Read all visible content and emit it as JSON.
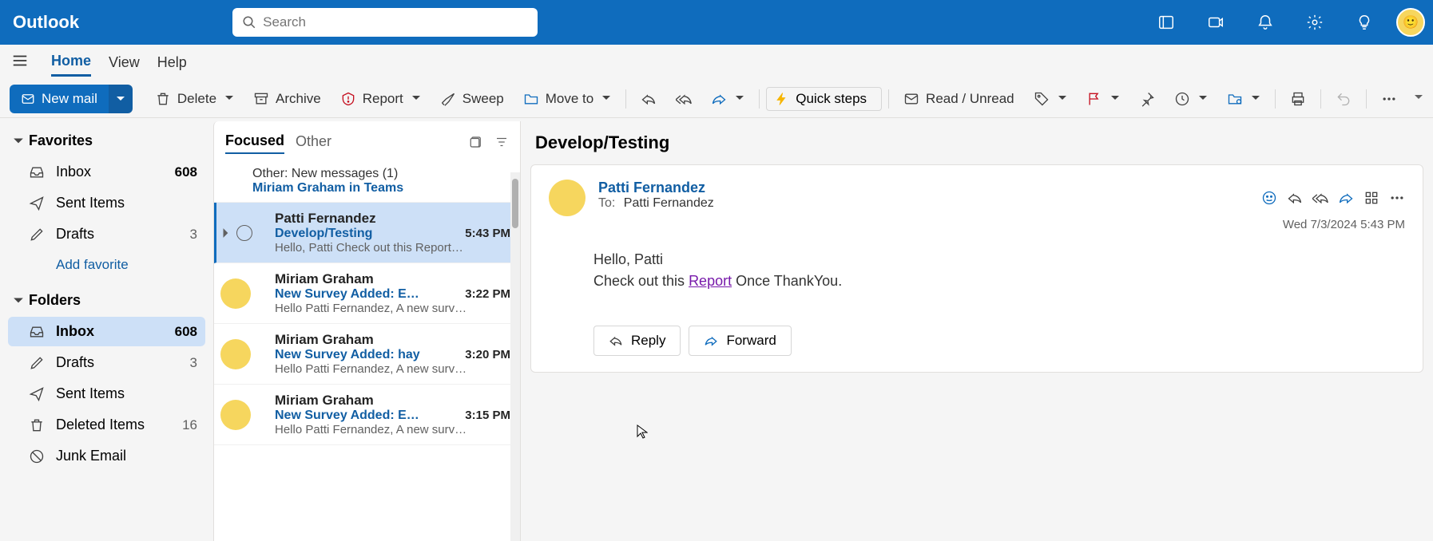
{
  "app": {
    "name": "Outlook"
  },
  "search": {
    "placeholder": "Search"
  },
  "tabs": {
    "home": "Home",
    "view": "View",
    "help": "Help"
  },
  "toolbar": {
    "newmail": "New mail",
    "delete": "Delete",
    "archive": "Archive",
    "report": "Report",
    "sweep": "Sweep",
    "moveto": "Move to",
    "quicksteps": "Quick steps",
    "readunread": "Read / Unread"
  },
  "sidebar": {
    "favorites": {
      "label": "Favorites",
      "inbox": {
        "label": "Inbox",
        "count": "608"
      },
      "sent": {
        "label": "Sent Items"
      },
      "drafts": {
        "label": "Drafts",
        "count": "3"
      },
      "add": "Add favorite"
    },
    "folders": {
      "label": "Folders",
      "inbox": {
        "label": "Inbox",
        "count": "608"
      },
      "drafts": {
        "label": "Drafts",
        "count": "3"
      },
      "sent": {
        "label": "Sent Items"
      },
      "deleted": {
        "label": "Deleted Items",
        "count": "16"
      },
      "junk": {
        "label": "Junk Email"
      }
    }
  },
  "msglist": {
    "focused": "Focused",
    "other": "Other",
    "banner": {
      "line1": "Other: New messages (1)",
      "line2": "Miriam Graham in Teams"
    },
    "items": [
      {
        "from": "Patti Fernandez",
        "subject": "Develop/Testing",
        "time": "5:43 PM",
        "preview": "Hello, Patti Check out this Report…",
        "selected": true,
        "checkbox": true
      },
      {
        "from": "Miriam Graham",
        "subject": "New Survey Added: E…",
        "time": "3:22 PM",
        "preview": "Hello Patti Fernandez, A new surv…",
        "selected": false,
        "checkbox": false
      },
      {
        "from": "Miriam Graham",
        "subject": "New Survey Added: hay",
        "time": "3:20 PM",
        "preview": "Hello Patti Fernandez, A new surv…",
        "selected": false,
        "checkbox": false
      },
      {
        "from": "Miriam Graham",
        "subject": "New Survey Added: E…",
        "time": "3:15 PM",
        "preview": "Hello Patti Fernandez, A new surv…",
        "selected": false,
        "checkbox": false
      }
    ]
  },
  "reading": {
    "subject": "Develop/Testing",
    "sender": "Patti Fernandez",
    "tolabel": "To:",
    "to": "Patti Fernandez",
    "date": "Wed 7/3/2024 5:43 PM",
    "body": {
      "line1": "Hello, Patti",
      "line2a": "Check out this ",
      "link": "Report",
      "line2b": " Once ThankYou."
    },
    "reply": "Reply",
    "forward": "Forward"
  }
}
